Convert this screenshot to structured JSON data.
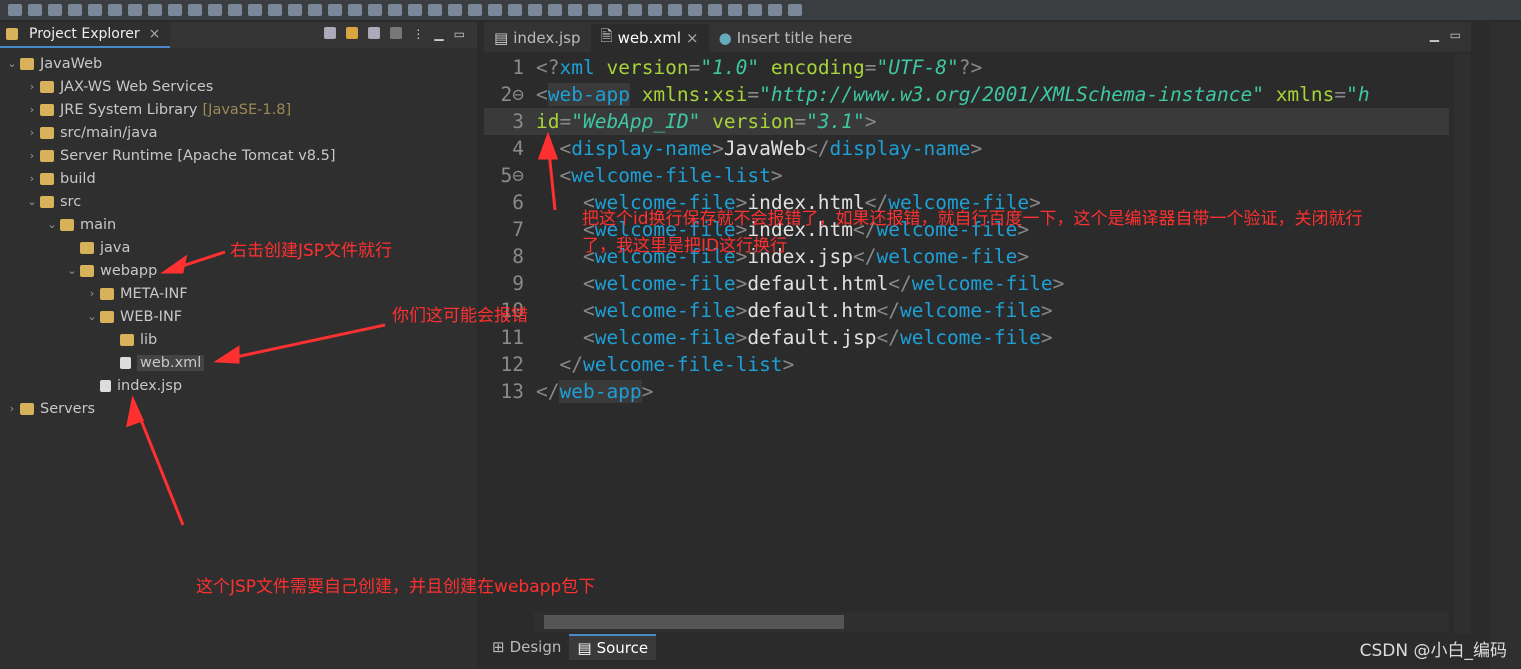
{
  "explorer": {
    "title": "Project Explorer",
    "tree": [
      {
        "label": "JavaWeb",
        "level": 0,
        "open": true
      },
      {
        "label": "JAX-WS Web Services",
        "level": 1
      },
      {
        "label": "JRE System Library",
        "suffix": "[JavaSE-1.8]",
        "level": 1
      },
      {
        "label": "src/main/java",
        "level": 1
      },
      {
        "label": "Server Runtime [Apache Tomcat v8.5]",
        "level": 1
      },
      {
        "label": "build",
        "level": 1
      },
      {
        "label": "src",
        "level": 1,
        "open": true
      },
      {
        "label": "main",
        "level": 2,
        "open": true
      },
      {
        "label": "java",
        "level": 3,
        "leaf": true
      },
      {
        "label": "webapp",
        "level": 3,
        "open": true
      },
      {
        "label": "META-INF",
        "level": 4
      },
      {
        "label": "WEB-INF",
        "level": 4,
        "open": true
      },
      {
        "label": "lib",
        "level": 5,
        "leaf": true
      },
      {
        "label": "web.xml",
        "level": 5,
        "leaf": true,
        "file": true,
        "selected": true
      },
      {
        "label": "index.jsp",
        "level": 4,
        "leaf": true,
        "file": true
      },
      {
        "label": "Servers",
        "level": 0
      }
    ]
  },
  "editor": {
    "tabs": [
      {
        "label": "index.jsp"
      },
      {
        "label": "web.xml",
        "active": true
      },
      {
        "label": "Insert title here"
      }
    ],
    "bottom_tabs": [
      {
        "label": "Design"
      },
      {
        "label": "Source",
        "active": true
      }
    ]
  },
  "annotations": {
    "right_click": "右击创建JSP文件就行",
    "may_error": "你们这可能会报错",
    "create_jsp": "这个JSP文件需要自己创建，并且创建在webapp包下",
    "id_line1": "把这个id换行保存就不会报错了，如果还报错，就自行百度一下，这个是编译器自带一个验证，关闭就行",
    "id_line2": "了，我这里是把ID这行换行"
  },
  "watermark": "CSDN @小白_编码"
}
